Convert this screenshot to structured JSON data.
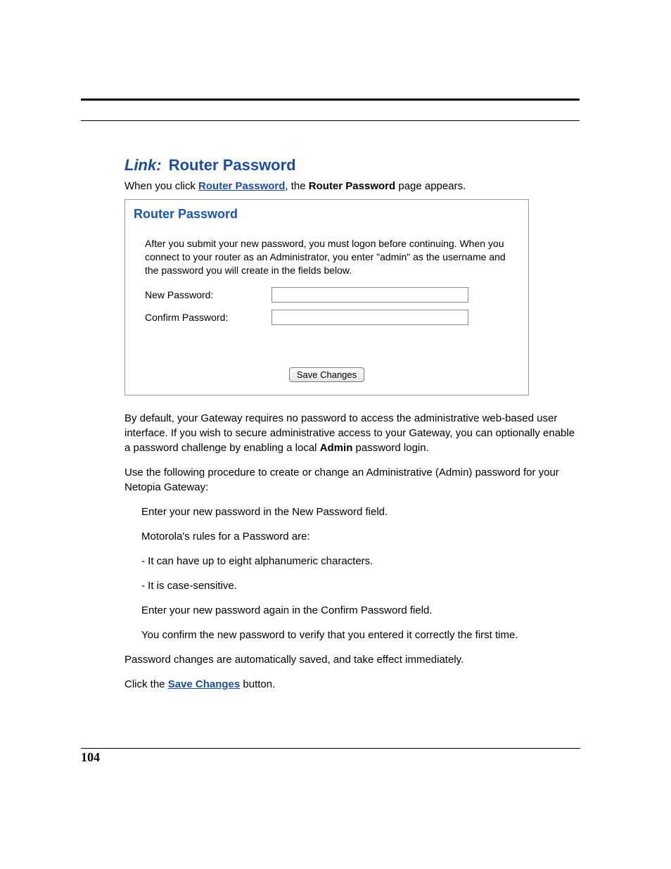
{
  "heading": {
    "link_prefix": "Link:",
    "title": "Router Password"
  },
  "intro": {
    "pre": "When you click ",
    "link": "Router Password",
    "mid": ", the ",
    "bold": "Router Password",
    "post": " page appears."
  },
  "panel": {
    "title": "Router Password",
    "description": "After you submit your new password, you must logon before continuing. When you connect to your router as an Administrator, you enter \"admin\" as the username and the password you will create in the fields below.",
    "new_password_label": "New Password:",
    "confirm_password_label": "Confirm Password:",
    "save_button": "Save Changes"
  },
  "body": {
    "p1_pre": "By default, your Gateway requires no password to access the administrative web-based user interface. If you wish to secure administrative access to your Gateway, you can optionally enable a password challenge by enabling a local ",
    "p1_bold": "Admin",
    "p1_post": " password login.",
    "p2": "Use the following procedure to create or change an Administrative (Admin) password for your Netopia Gateway:",
    "li1": "Enter your new password in the New Password field.",
    "li2": "Motorola's rules for a Password are:",
    "li3": "- It can have up to eight alphanumeric characters.",
    "li4": "- It is case-sensitive.",
    "li5": "Enter your new password again in the Confirm Password field.",
    "li6": "You confirm the new password to verify that you entered it correctly the first time.",
    "p3": "Password changes are automatically saved, and take effect immediately.",
    "p4_pre": "Click the ",
    "p4_link": "Save Changes",
    "p4_post": " button."
  },
  "page_number": "104"
}
